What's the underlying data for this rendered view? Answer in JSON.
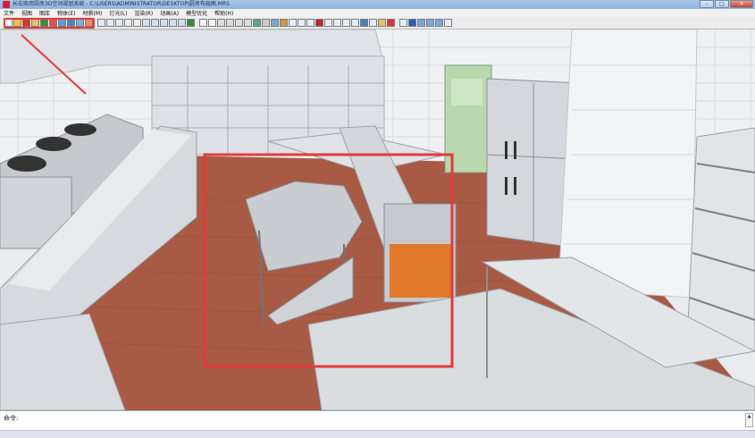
{
  "window": {
    "title": "长宏商用厨房3D空间规划系统 - C:\\USERS\\ADMINISTRATOR\\DESKTOP\\厨房布局图.MRS",
    "minimize": "–",
    "maximize": "□",
    "close": "✕"
  },
  "menu": [
    "文件",
    "视图",
    "图库",
    "物体(E)",
    "材质(M)",
    "灯光(L)",
    "渲染(R)",
    "动画(A)",
    "模型优化",
    "帮助(H)"
  ],
  "command": {
    "label": "命令:",
    "value": ""
  },
  "colors": {
    "highlight": "#e23b3b",
    "wall": "#f2f4f6",
    "floor": "#a85a45",
    "stainless": "#c9cdd2",
    "door": "#b9d8b0",
    "heater": "#e2792a"
  }
}
